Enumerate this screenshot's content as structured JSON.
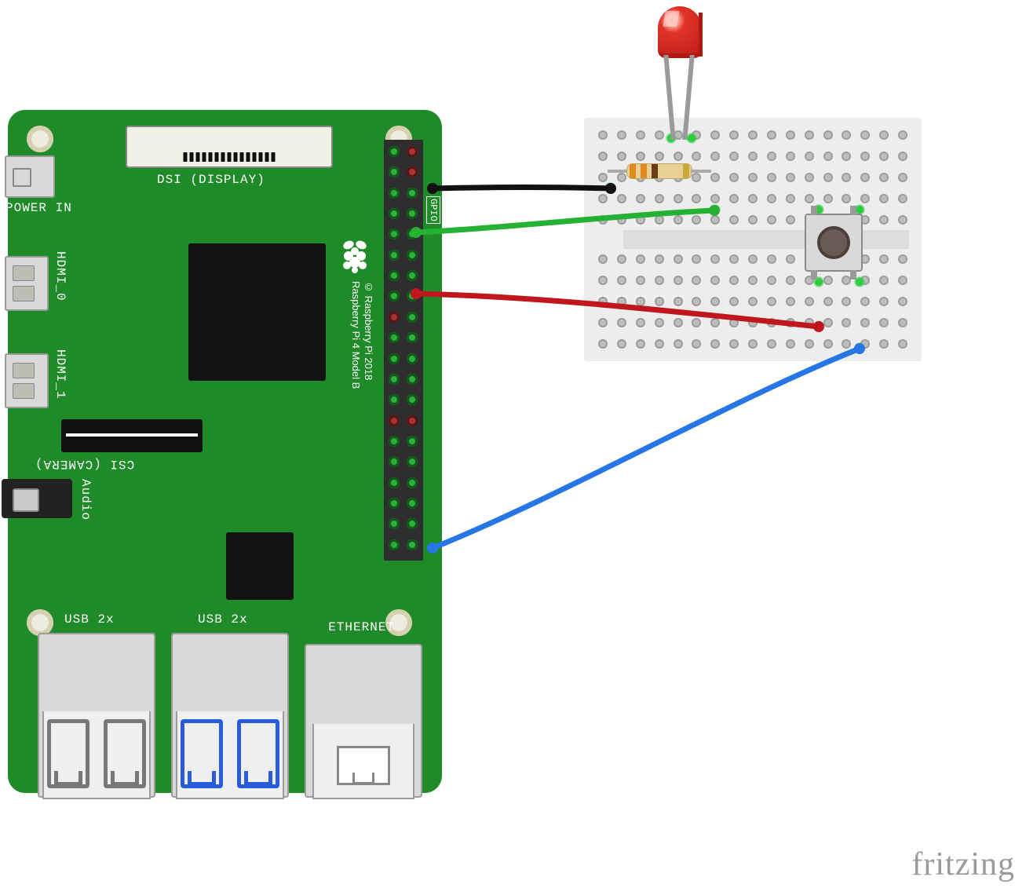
{
  "watermark": "fritzing",
  "pi": {
    "dsi_label": "DSI (DISPLAY)",
    "power_label": "POWER IN",
    "hdmi0_label": "HDMI_0",
    "hdmi1_label": "HDMI_1",
    "csi_label": "CSI (CAMERA)",
    "audio_label": "Audio",
    "gpio_label": "GPIO",
    "ethernet_label": "ETHERNET",
    "usb2_label": "USB 2x",
    "usb3_label": "USB 2x",
    "model_line1": "Raspberry Pi 4 Model B",
    "model_line2": "© Raspberry Pi 2018"
  },
  "components": {
    "led": {
      "color": "#e03329",
      "name": "red-led"
    },
    "resistor": {
      "bands": [
        "orange",
        "orange",
        "brown",
        "gold"
      ],
      "name": "resistor-330"
    },
    "button": {
      "name": "tactile-pushbutton"
    }
  },
  "wires": [
    {
      "name": "gnd-wire",
      "color": "#111111"
    },
    {
      "name": "gpio-led-wire",
      "color": "#25b233"
    },
    {
      "name": "vcc-wire",
      "color": "#c0171f"
    },
    {
      "name": "gpio-button-wire",
      "color": "#2776e6"
    }
  ]
}
